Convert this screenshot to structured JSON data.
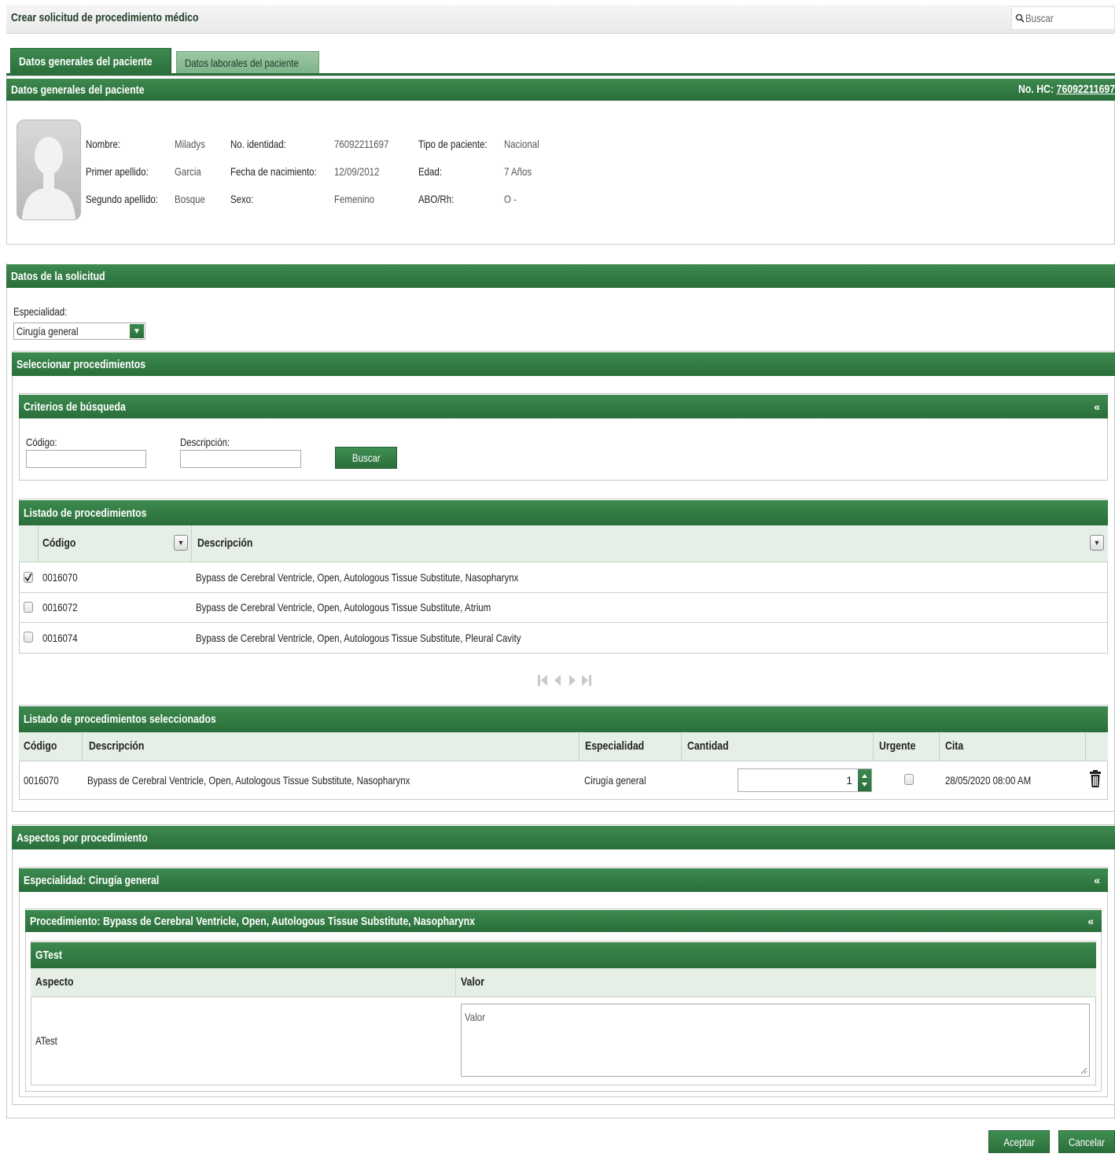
{
  "topbar": {
    "title": "Crear solicitud de procedimiento médico",
    "search_placeholder": "Buscar"
  },
  "tabs": [
    {
      "label": "Datos generales del paciente",
      "active": true
    },
    {
      "label": "Datos laborales del paciente",
      "active": false
    }
  ],
  "patient": {
    "section_title": "Datos generales del paciente",
    "hc_label": "No. HC:",
    "hc_value": "76092211697",
    "fields": {
      "nombre_label": "Nombre:",
      "nombre": "Miladys",
      "primer_label": "Primer apellido:",
      "primer": "Garcia",
      "segundo_label": "Segundo apellido:",
      "segundo": "Bosque",
      "identidad_label": "No. identidad:",
      "identidad": "76092211697",
      "nacimiento_label": "Fecha de nacimiento:",
      "nacimiento": "12/09/2012",
      "sexo_label": "Sexo:",
      "sexo": "Femenino",
      "tipo_label": "Tipo de paciente:",
      "tipo": "Nacional",
      "edad_label": "Edad:",
      "edad": "7 Años",
      "abo_label": "ABO/Rh:",
      "abo": "O -"
    }
  },
  "solicitud": {
    "section_title": "Datos de la solicitud",
    "especialidad_label": "Especialidad:",
    "especialidad_value": "Cirugía general"
  },
  "seleccionar": {
    "title": "Seleccionar procedimientos",
    "criterios": {
      "title": "Criterios de búsqueda",
      "codigo_label": "Código:",
      "descripcion_label": "Descripción:",
      "buscar_label": "Buscar"
    },
    "listado": {
      "title": "Listado de procedimientos",
      "col_codigo": "Código",
      "col_descripcion": "Descripción",
      "rows": [
        {
          "codigo": "0016070",
          "descripcion": "Bypass de Cerebral Ventricle, Open, Autologous Tissue Substitute, Nasopharynx",
          "checked": true
        },
        {
          "codigo": "0016072",
          "descripcion": "Bypass de Cerebral Ventricle, Open, Autologous Tissue Substitute, Atrium",
          "checked": false
        },
        {
          "codigo": "0016074",
          "descripcion": "Bypass de Cerebral Ventricle, Open, Autologous Tissue Substitute, Pleural Cavity",
          "checked": false
        }
      ]
    },
    "seleccionados": {
      "title": "Listado de procedimientos seleccionados",
      "col_codigo": "Código",
      "col_descripcion": "Descripción",
      "col_especialidad": "Especialidad",
      "col_cantidad": "Cantidad",
      "col_urgente": "Urgente",
      "col_cita": "Cita",
      "row": {
        "codigo": "0016070",
        "descripcion": "Bypass de Cerebral Ventricle, Open, Autologous Tissue Substitute, Nasopharynx",
        "especialidad": "Cirugía general",
        "cantidad": "1",
        "urgente": false,
        "cita": "28/05/2020 08:00 AM"
      }
    }
  },
  "aspectos": {
    "title": "Aspectos por procedimiento",
    "especialidad_title": "Especialidad: Cirugía general",
    "procedimiento_title": "Procedimiento: Bypass de Cerebral Ventricle, Open, Autologous Tissue Substitute, Nasopharynx",
    "group_title": "GTest",
    "col_aspecto": "Aspecto",
    "col_valor": "Valor",
    "row": {
      "aspecto": "ATest",
      "valor_placeholder": "Valor"
    }
  },
  "footer": {
    "aceptar_label": "Aceptar",
    "cancelar_label": "Cancelar"
  },
  "colors": {
    "header_green": "#2f7a3f",
    "table_head": "#e6efe6"
  }
}
